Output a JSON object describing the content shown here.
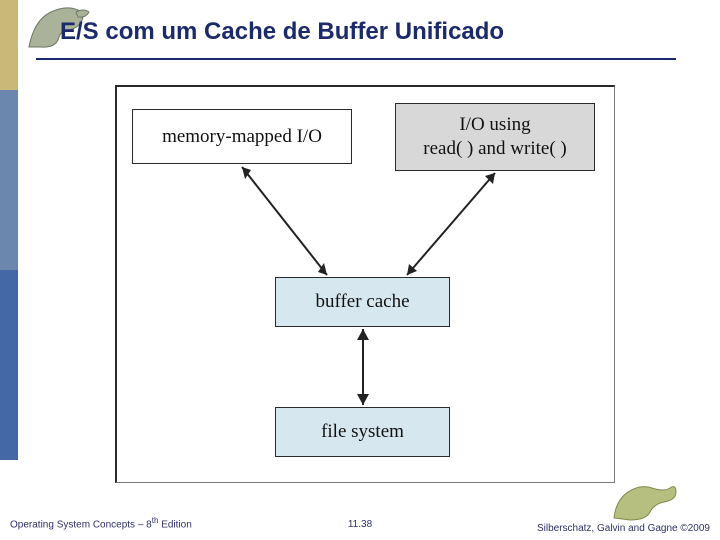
{
  "title": "E/S com um Cache de Buffer Unificado",
  "diagram": {
    "memory_mapped_label": "memory-mapped I/O",
    "read_write_label": "I/O using\nread( ) and write( )",
    "buffer_cache_label": "buffer cache",
    "file_system_label": "file system"
  },
  "footer": {
    "left_prefix": "Operating System Concepts – 8",
    "left_suffix": " Edition",
    "left_super": "th",
    "page": "11.38",
    "right": "Silberschatz, Galvin and Gagne ©2009"
  },
  "chart_data": {
    "type": "diagram",
    "nodes": [
      {
        "id": "mm",
        "label": "memory-mapped I/O"
      },
      {
        "id": "rw",
        "label": "I/O using read( ) and write( )"
      },
      {
        "id": "buf",
        "label": "buffer cache"
      },
      {
        "id": "fs",
        "label": "file system"
      }
    ],
    "edges": [
      {
        "from": "mm",
        "to": "buf",
        "bidirectional": true
      },
      {
        "from": "rw",
        "to": "buf",
        "bidirectional": true
      },
      {
        "from": "buf",
        "to": "fs",
        "bidirectional": true
      }
    ]
  }
}
